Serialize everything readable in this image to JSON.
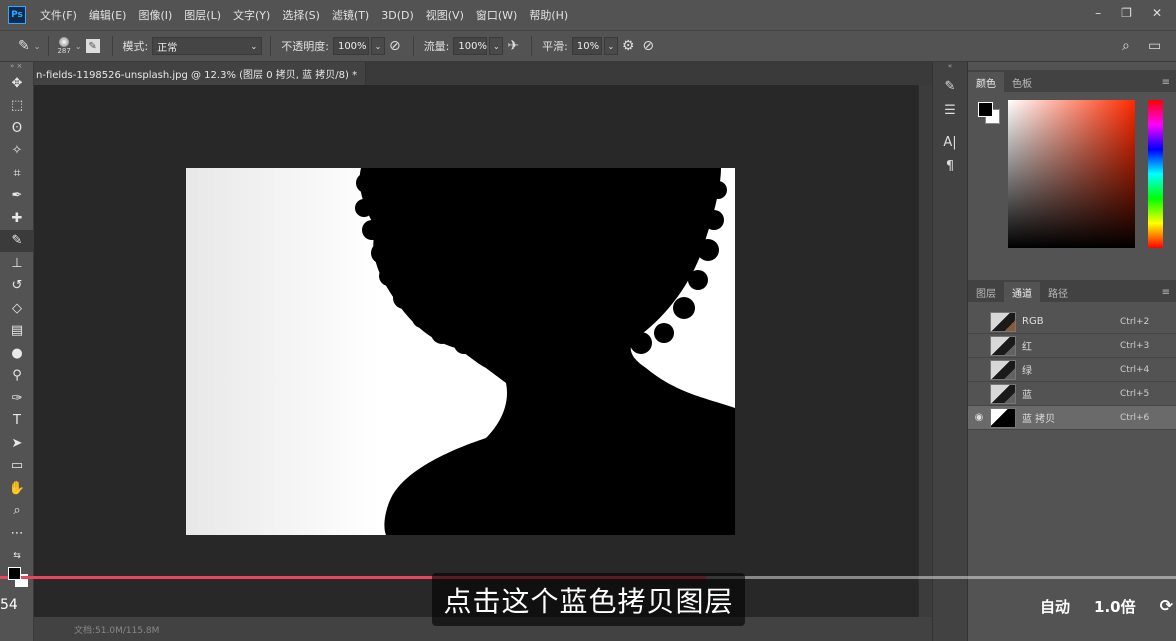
{
  "app": {
    "logo": "Ps"
  },
  "menu": [
    "文件(F)",
    "编辑(E)",
    "图像(I)",
    "图层(L)",
    "文字(Y)",
    "选择(S)",
    "滤镜(T)",
    "3D(D)",
    "视图(V)",
    "窗口(W)",
    "帮助(H)"
  ],
  "options": {
    "brush_size": "287",
    "mode_label": "模式:",
    "mode_value": "正常",
    "opacity_label": "不透明度:",
    "opacity_value": "100%",
    "flow_label": "流量:",
    "flow_value": "100%",
    "smoothing_label": "平滑:",
    "smoothing_value": "10%"
  },
  "document": {
    "tab_title": "n-fields-1198526-unsplash.jpg @ 12.3% (图层 0 拷贝, 蓝 拷贝/8) *",
    "close": "×"
  },
  "color_panel": {
    "tabs": [
      "颜色",
      "色板"
    ],
    "fg": "#000000",
    "bg": "#ffffff"
  },
  "channels_panel": {
    "tabs": [
      "图层",
      "通道",
      "路径"
    ],
    "channels": [
      {
        "name": "RGB",
        "shortcut": "Ctrl+2",
        "visible": false,
        "selected": false
      },
      {
        "name": "红",
        "shortcut": "Ctrl+3",
        "visible": false,
        "selected": false
      },
      {
        "name": "绿",
        "shortcut": "Ctrl+4",
        "visible": false,
        "selected": false
      },
      {
        "name": "蓝",
        "shortcut": "Ctrl+5",
        "visible": false,
        "selected": false
      },
      {
        "name": "蓝 拷贝",
        "shortcut": "Ctrl+6",
        "visible": true,
        "selected": true
      }
    ]
  },
  "status": {
    "doc_size": "文档:51.0M/115.8M"
  },
  "video": {
    "subtitle": "点击这个蓝色拷贝图层",
    "time_partial": "54",
    "quality": "自动",
    "speed": "1.0倍",
    "progress": 0.6
  }
}
